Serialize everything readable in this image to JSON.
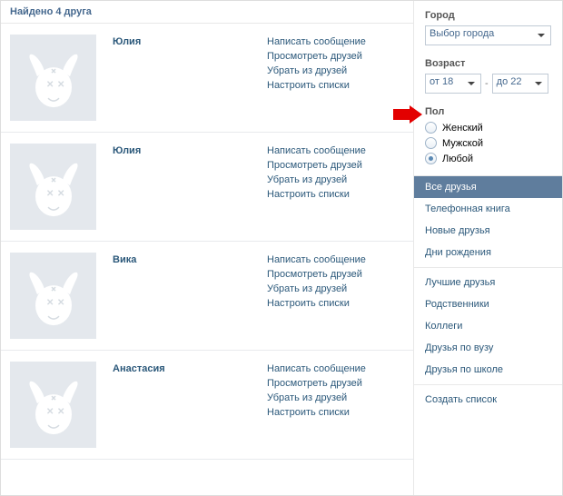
{
  "header": {
    "title": "Найдено 4 друга"
  },
  "friends": [
    {
      "name": "Юлия",
      "actions": [
        "Написать сообщение",
        "Просмотреть друзей",
        "Убрать из друзей",
        "Настроить списки"
      ]
    },
    {
      "name": "Юлия",
      "actions": [
        "Написать сообщение",
        "Просмотреть друзей",
        "Убрать из друзей",
        "Настроить списки"
      ]
    },
    {
      "name": "Вика",
      "actions": [
        "Написать сообщение",
        "Просмотреть друзей",
        "Убрать из друзей",
        "Настроить списки"
      ]
    },
    {
      "name": "Анастасия",
      "actions": [
        "Написать сообщение",
        "Просмотреть друзей",
        "Убрать из друзей",
        "Настроить списки"
      ]
    }
  ],
  "filters": {
    "city_label": "Город",
    "city_value": "Выбор города",
    "age_label": "Возраст",
    "age_from": "от 18",
    "age_to": "до 22",
    "age_dash": "-",
    "gender_label": "Пол",
    "genders": [
      {
        "label": "Женский",
        "checked": false
      },
      {
        "label": "Мужской",
        "checked": false
      },
      {
        "label": "Любой",
        "checked": true
      }
    ]
  },
  "menu": {
    "group1": [
      {
        "label": "Все друзья",
        "active": true
      },
      {
        "label": "Телефонная книга",
        "active": false
      },
      {
        "label": "Новые друзья",
        "active": false
      },
      {
        "label": "Дни рождения",
        "active": false
      }
    ],
    "group2": [
      {
        "label": "Лучшие друзья"
      },
      {
        "label": "Родственники"
      },
      {
        "label": "Коллеги"
      },
      {
        "label": "Друзья по вузу"
      },
      {
        "label": "Друзья по школе"
      }
    ],
    "group3": [
      {
        "label": "Создать список"
      }
    ]
  }
}
